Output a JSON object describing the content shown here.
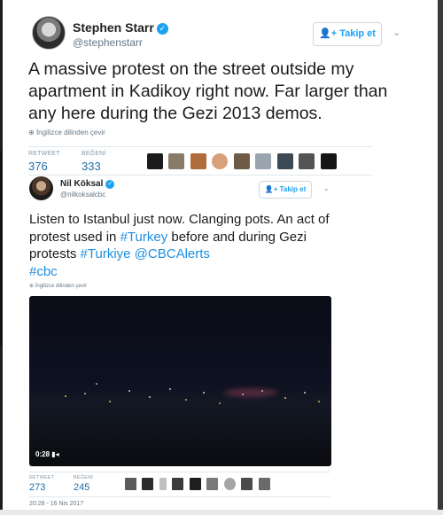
{
  "outer_tweet": {
    "name": "Stephen Starr",
    "handle": "@stephenstarr",
    "follow_label": "Takip et",
    "follow_icon": "add-user-icon",
    "text": "A massive protest on the street outside my apartment in Kadikoy right now. Far larger than any here during the Gezi 2013 demos.",
    "translate_label": "İngilizce dilinden çevir",
    "retweet_label": "RETWEET",
    "retweet_count": "376",
    "like_label": "BEĞENİ",
    "like_count": "333"
  },
  "inner_tweet": {
    "name": "Nil Köksal",
    "handle": "@nilkoksalcbc",
    "follow_label": "Takip et",
    "text_plain_1": "Listen to Istanbul just now. Clanging pots. An act of protest used in ",
    "hashtag_turkey": "#Turkey",
    "text_plain_2": " before and during Gezi protests ",
    "hashtag_turkiye": "#Turkiye",
    "mention_cbc": "@CBCAlerts",
    "hashtag_cbc": "#cbc",
    "translate_label": "İngilizce dilinden çevir",
    "video_duration": "0:28",
    "retweet_label": "RETWEET",
    "retweet_count": "273",
    "like_label": "BEĞENİ",
    "like_count": "245",
    "timestamp": "20:28 - 16 Nis 2017"
  },
  "colors": {
    "link": "#1d8fe0",
    "verified": "#1da1f2",
    "stat_value": "#1f6fa6"
  }
}
